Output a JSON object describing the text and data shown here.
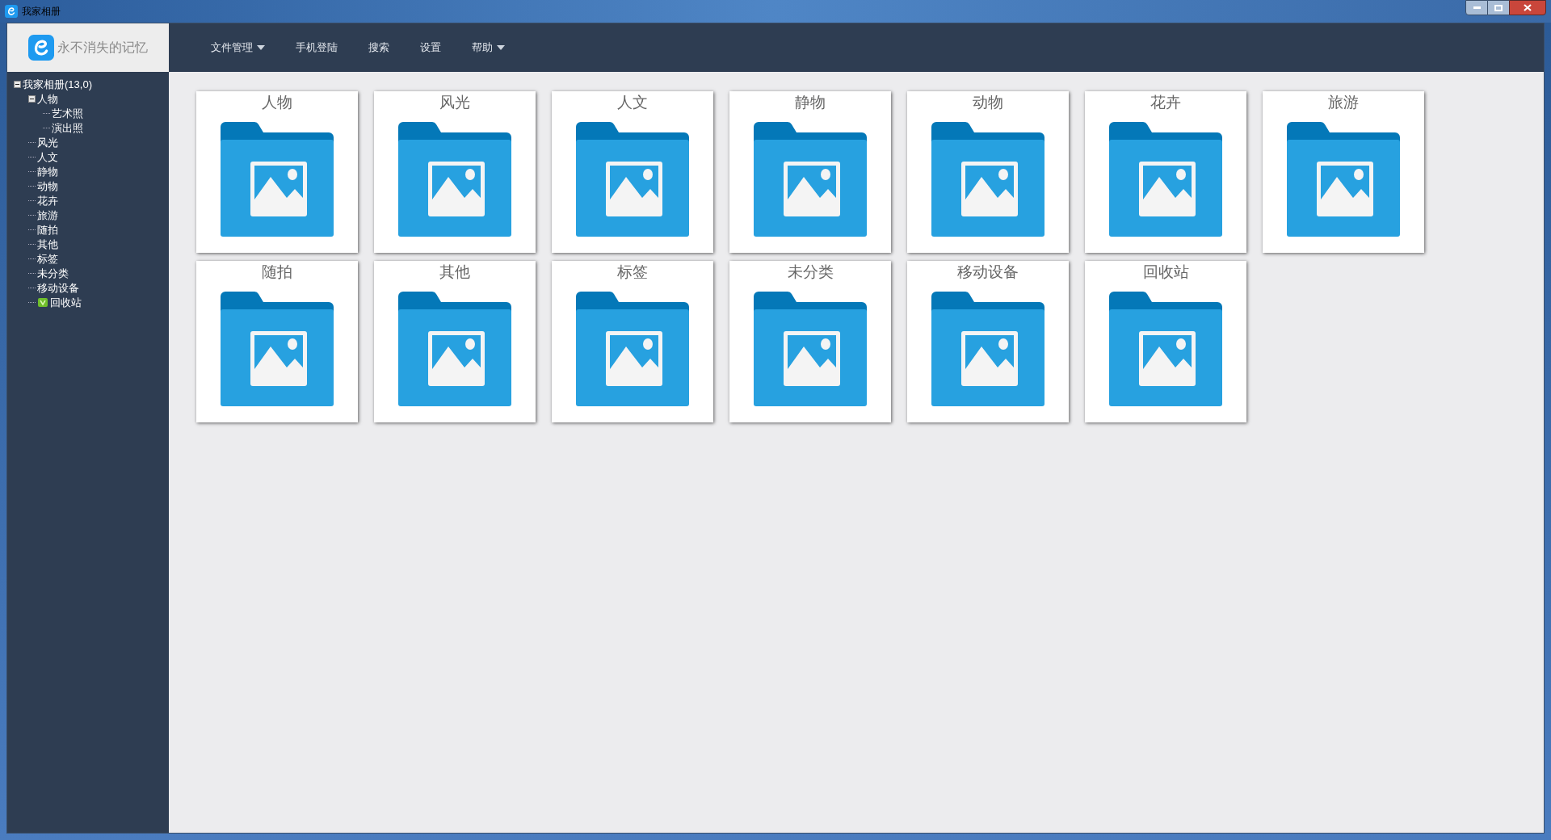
{
  "window": {
    "title": "我家相册"
  },
  "logo": {
    "text": "永不消失的记忆"
  },
  "menu": [
    {
      "label": "文件管理",
      "dropdown": true
    },
    {
      "label": "手机登陆",
      "dropdown": false
    },
    {
      "label": "搜索",
      "dropdown": false
    },
    {
      "label": "设置",
      "dropdown": false
    },
    {
      "label": "帮助",
      "dropdown": true
    }
  ],
  "tree": [
    {
      "label": "我家相册(13,0)",
      "expanded": true,
      "children": [
        {
          "label": "人物",
          "expanded": true,
          "children": [
            {
              "label": "艺术照"
            },
            {
              "label": "演出照"
            }
          ]
        },
        {
          "label": "风光"
        },
        {
          "label": "人文"
        },
        {
          "label": "静物"
        },
        {
          "label": "动物"
        },
        {
          "label": "花卉"
        },
        {
          "label": "旅游"
        },
        {
          "label": "随拍"
        },
        {
          "label": "其他"
        },
        {
          "label": "标签"
        },
        {
          "label": "未分类"
        },
        {
          "label": "移动设备"
        },
        {
          "label": "回收站",
          "recycle_bin_icon": true
        }
      ]
    }
  ],
  "albums": [
    {
      "label": "人物"
    },
    {
      "label": "风光"
    },
    {
      "label": "人文"
    },
    {
      "label": "静物"
    },
    {
      "label": "动物"
    },
    {
      "label": "花卉"
    },
    {
      "label": "旅游"
    },
    {
      "label": "随拍"
    },
    {
      "label": "其他"
    },
    {
      "label": "标签"
    },
    {
      "label": "未分类"
    },
    {
      "label": "移动设备"
    },
    {
      "label": "回收站"
    }
  ]
}
